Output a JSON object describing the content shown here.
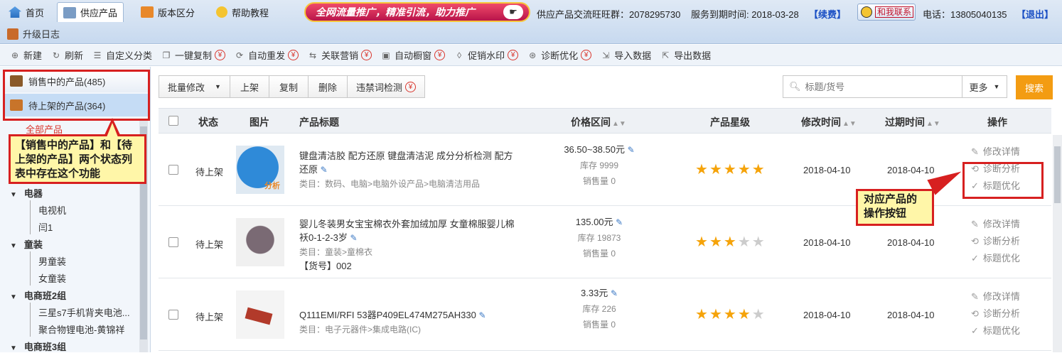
{
  "topbar": {
    "tabs": [
      {
        "label": "首页",
        "icon": "home-icon"
      },
      {
        "label": "供应产品",
        "icon": "box-icon"
      },
      {
        "label": "版本区分",
        "icon": "check-icon"
      },
      {
        "label": "帮助教程",
        "icon": "help-icon"
      }
    ],
    "banner": "全网流量推广，精准引流，助力推广",
    "group": "供应产品交流旺旺群：2078295730",
    "expire": "服务到期时间: 2018-03-28",
    "renew": "【续费】",
    "contact": "和我联系",
    "phone": "电话：13805040135",
    "logout": "【退出】",
    "upgrade": "升级日志"
  },
  "toolbar": [
    {
      "label": "新建",
      "icon": "plus-icon",
      "paid": false
    },
    {
      "label": "刷新",
      "icon": "refresh-icon",
      "paid": false
    },
    {
      "label": "自定义分类",
      "icon": "list-icon",
      "paid": false
    },
    {
      "label": "一键复制",
      "icon": "copy-icon",
      "paid": true
    },
    {
      "label": "自动重发",
      "icon": "repeat-icon",
      "paid": true
    },
    {
      "label": "关联营销",
      "icon": "link-icon",
      "paid": true
    },
    {
      "label": "自动橱窗",
      "icon": "window-icon",
      "paid": true
    },
    {
      "label": "促销水印",
      "icon": "drop-icon",
      "paid": true
    },
    {
      "label": "诊断优化",
      "icon": "diagnose-icon",
      "paid": true
    },
    {
      "label": "导入数据",
      "icon": "import-icon",
      "paid": false
    },
    {
      "label": "导出数据",
      "icon": "export-icon",
      "paid": false
    }
  ],
  "paid_symbol": "¥",
  "left": {
    "on_sale": "销售中的产品(485)",
    "pending": "待上架的产品(364)",
    "all": "全部产品",
    "callout": "【销售中的产品】和【待上架的产品】两个状态列表中存在这个功能",
    "tree": [
      {
        "label": "电器",
        "children": [
          "电视机",
          "闫1"
        ]
      },
      {
        "label": "童装",
        "children": [
          "男童装",
          "女童装"
        ]
      },
      {
        "label": "电商班2组",
        "children": [
          "三星s7手机背夹电池...",
          "聚合物锂电池-黄锦祥"
        ]
      },
      {
        "label": "电商班3组",
        "children": []
      }
    ]
  },
  "actions": {
    "batch": "批量修改",
    "shelve": "上架",
    "copy": "复制",
    "delete": "删除",
    "check": "违禁词检测",
    "search_placeholder": "标题/货号",
    "more": "更多",
    "search_btn": "搜索"
  },
  "columns": {
    "status": "状态",
    "image": "图片",
    "title": "产品标题",
    "price": "价格区间",
    "rating": "产品星级",
    "modified": "修改时间",
    "expire": "过期时间",
    "ops": "操作"
  },
  "rows": [
    {
      "status": "待上架",
      "title": "键盘清洁胶 配方还原 键盘清洁泥 成分分析检测 配方还原",
      "category": "类目：数码、电脑>电脑外设产品>电脑清洁用品",
      "sku": "",
      "price": "36.50~38.50元",
      "stock": "库存 9999",
      "sold": "销售量 0",
      "stars": 5,
      "modified": "2018-04-10",
      "expire": "2018-04-10",
      "img_text": "分析"
    },
    {
      "status": "待上架",
      "title": "婴儿冬装男女宝宝棉衣外套加绒加厚 女童棉服婴儿棉袄0-1-2-3岁",
      "category": "类目：童装>童棉衣",
      "sku": "【货号】002",
      "price": "135.00元",
      "stock": "库存 19873",
      "sold": "销售量 0",
      "stars": 3,
      "modified": "2018-04-10",
      "expire": "2018-04-10",
      "img_text": ""
    },
    {
      "status": "待上架",
      "title": "Q111EMI/RFI 53器P409EL474M275AH330",
      "category": "类目：电子元器件>集成电路(IC)",
      "sku": "",
      "price": "3.33元",
      "stock": "库存 226",
      "sold": "销售量 0",
      "stars": 4,
      "modified": "2018-04-10",
      "expire": "2018-04-10",
      "img_text": ""
    }
  ],
  "ops": {
    "edit": "修改详情",
    "diagnose": "诊断分析",
    "optimize": "标题优化"
  },
  "callout2": "对应产品的操作按钮"
}
